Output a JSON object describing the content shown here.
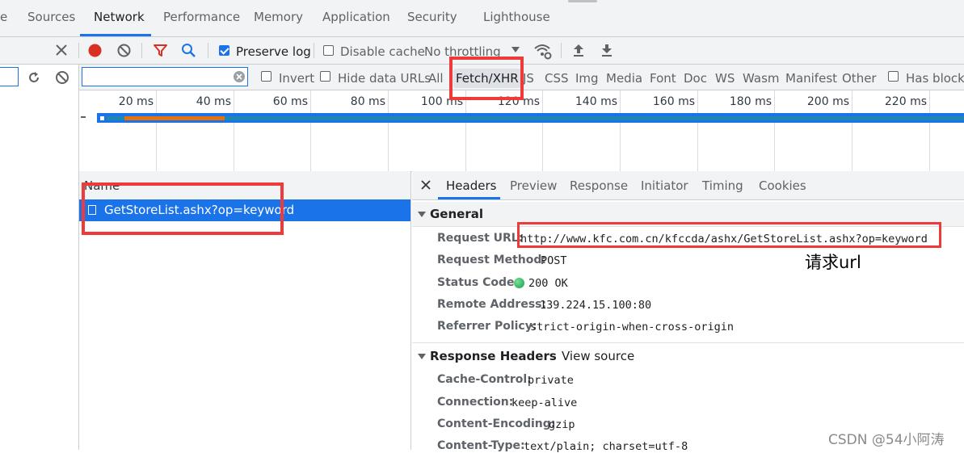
{
  "tabs": [
    "e",
    "Sources",
    "Network",
    "Performance",
    "Memory",
    "Application",
    "Security",
    "Lighthouse"
  ],
  "active_tab": "Network",
  "toolbar": {
    "preserve_log_label": "Preserve log",
    "preserve_log_checked": true,
    "disable_cache_label": "Disable cache",
    "disable_cache_checked": false,
    "throttling_value": "No throttling"
  },
  "filter": {
    "search_value": "",
    "invert_label": "Invert",
    "hide_data_urls_label": "Hide data URLs",
    "types": [
      "All",
      "Fetch/XHR",
      "JS",
      "CSS",
      "Img",
      "Media",
      "Font",
      "Doc",
      "WS",
      "Wasm",
      "Manifest",
      "Other"
    ],
    "selected_type": "Fetch/XHR",
    "has_blocked_label": "Has blocke"
  },
  "timeline": {
    "ticks": [
      "20 ms",
      "40 ms",
      "60 ms",
      "80 ms",
      "100 ms",
      "120 ms",
      "140 ms",
      "160 ms",
      "180 ms",
      "200 ms",
      "220 ms"
    ]
  },
  "requests": {
    "column_name": "Name",
    "items": [
      {
        "name": "GetStoreList.ashx?op=keyword",
        "selected": true
      }
    ]
  },
  "details": {
    "tabs": [
      "Headers",
      "Preview",
      "Response",
      "Initiator",
      "Timing",
      "Cookies"
    ],
    "active_tab": "Headers",
    "general_title": "General",
    "general": [
      {
        "key": "Request URL:",
        "value": "http://www.kfc.com.cn/kfccda/ashx/GetStoreList.ashx?op=keyword"
      },
      {
        "key": "Request Method:",
        "value": "POST"
      },
      {
        "key": "Status Code:",
        "value": "200 OK"
      },
      {
        "key": "Remote Address:",
        "value": "139.224.15.100:80"
      },
      {
        "key": "Referrer Policy:",
        "value": "strict-origin-when-cross-origin"
      }
    ],
    "response_headers_title": "Response Headers",
    "view_source_label": "View source",
    "response_headers": [
      {
        "key": "Cache-Control:",
        "value": "private"
      },
      {
        "key": "Connection:",
        "value": "keep-alive"
      },
      {
        "key": "Content-Encoding:",
        "value": "gzip"
      },
      {
        "key": "Content-Type:",
        "value": "text/plain; charset=utf-8"
      }
    ]
  },
  "annotation_text": "请求url",
  "watermark": "CSDN @54小阿涛",
  "colors": {
    "accent": "#1a73e8",
    "record": "#d93025",
    "highlight_box": "#ef3a3a",
    "status_ok": "#0f9d58",
    "timeline_bar": "#1e88b0",
    "timeline_orange": "#e8710a"
  },
  "icons": [
    "close-icon",
    "record-icon",
    "clear-icon",
    "filter-icon",
    "search-icon",
    "wifi-settings-icon",
    "upload-icon",
    "download-icon",
    "reload-icon",
    "block-icon",
    "clear-input-icon",
    "status-ok-icon"
  ]
}
